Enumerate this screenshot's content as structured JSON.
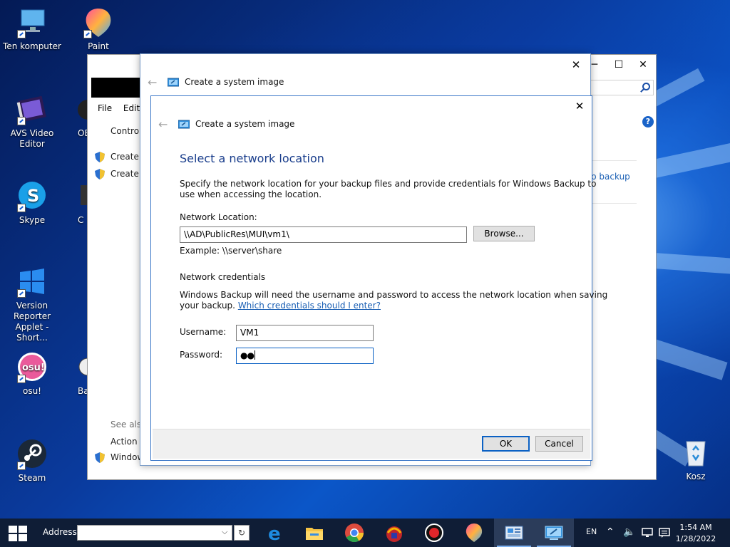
{
  "desktop": {
    "icons": [
      {
        "label": "Ten komputer",
        "icon": "this-pc-icon"
      },
      {
        "label": "Paint",
        "icon": "paint-icon"
      },
      {
        "label": "AVS Video Editor",
        "icon": "film-icon"
      },
      {
        "label": "OB",
        "icon": "obs-icon"
      },
      {
        "label": "Skype",
        "icon": "skype-icon"
      },
      {
        "label": "C",
        "icon": "app-icon"
      },
      {
        "label": "Version Reporter Applet - Short...",
        "icon": "windows-logo-icon"
      },
      {
        "label": "osu!",
        "icon": "osu-icon"
      },
      {
        "label": "Ba",
        "icon": "app-icon"
      },
      {
        "label": "Steam",
        "icon": "steam-icon"
      },
      {
        "label": "Kosz",
        "icon": "recycle-bin-icon"
      }
    ]
  },
  "background_window": {
    "menu": [
      "File",
      "Edit"
    ],
    "control_text": "Control",
    "tasks": [
      "Create a",
      "Create a"
    ],
    "link_right": "p backup",
    "see_also": "See also",
    "see_also_items": [
      "Action C",
      "Window"
    ]
  },
  "outer_dialog": {
    "title": "Create a system image"
  },
  "dialog": {
    "title": "Create a system image",
    "heading": "Select a network location",
    "description_line1": "Specify the network location for your backup files and provide credentials for Windows Backup to",
    "description_line2": "use when accessing the location.",
    "network_location_label": "Network Location:",
    "network_location_value": "\\\\AD\\PublicRes\\MUI\\vm1\\",
    "browse_label": "Browse...",
    "example": "Example: \\\\server\\share",
    "credentials_header": "Network credentials",
    "credentials_line1": "Windows Backup will need the username and password to access the network location when saving",
    "credentials_line2_prefix": "your backup.",
    "credentials_link": "Which credentials should I enter?",
    "username_label": "Username:",
    "username_value": "VM1",
    "password_label": "Password:",
    "password_value": "●●",
    "ok_label": "OK",
    "cancel_label": "Cancel"
  },
  "taskbar": {
    "address_label": "Address",
    "apps": [
      "edge-icon",
      "file-explorer-icon",
      "chrome-icon",
      "app-icon",
      "record-icon",
      "paint-icon",
      "control-panel-icon",
      "backup-icon"
    ],
    "language": "EN",
    "time": "1:54 AM",
    "date": "1/28/2022"
  },
  "colors": {
    "accent": "#0b61c4",
    "heading": "#1a3e8c",
    "link": "#1a5fb4",
    "taskbar": "#0f1d36"
  }
}
